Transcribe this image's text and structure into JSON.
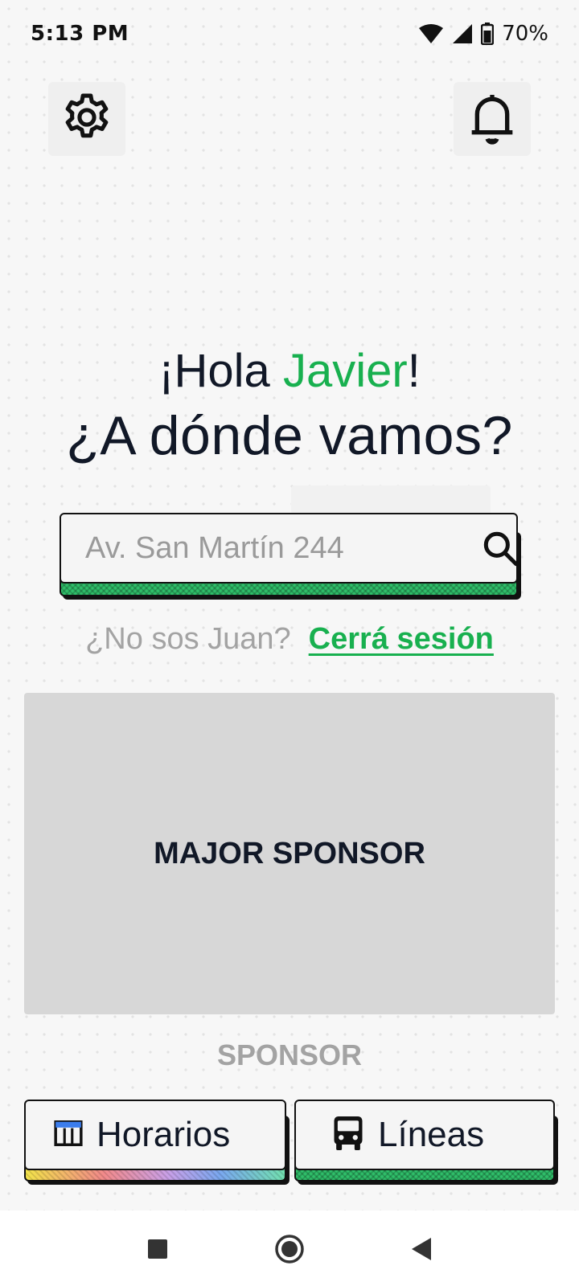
{
  "status_bar": {
    "time": "5:13 PM",
    "battery": "70%"
  },
  "greeting": {
    "hello_prefix": "¡Hola ",
    "user_name": "Javier",
    "hello_suffix": "!",
    "question": "¿A dónde vamos?"
  },
  "search": {
    "placeholder": "Av. San Martín 244",
    "value": ""
  },
  "session": {
    "not_you": "¿No sos Juan?",
    "logout_label": "Cerrá sesión"
  },
  "sponsors": {
    "major_label": "MAJOR SPONSOR",
    "minor_label": "SPONSOR"
  },
  "actions": {
    "schedules_label": "Horarios",
    "lines_label": "Líneas"
  },
  "colors": {
    "accent": "#18b04f",
    "text": "#111827",
    "muted": "#a3a3a3",
    "sponsor_bg": "#d7d7d7"
  },
  "icons": {
    "settings": "gear-icon",
    "notifications": "bell-icon",
    "search": "search-icon",
    "schedules": "calendar-table-icon",
    "lines": "bus-icon"
  }
}
